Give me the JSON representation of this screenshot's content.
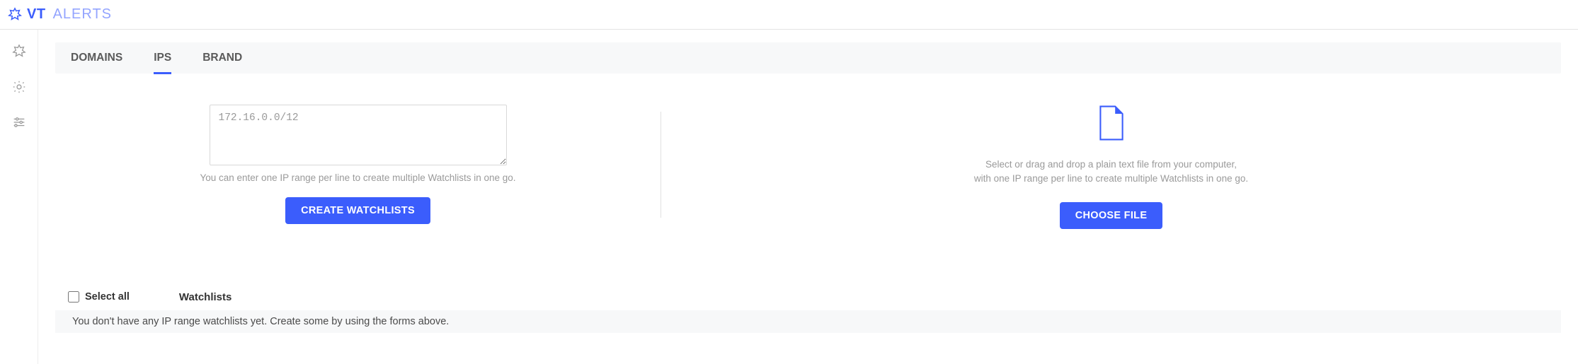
{
  "header": {
    "brand_bold": "VT",
    "brand_light": "ALERTS"
  },
  "sidebar": {
    "icons": [
      "maple-icon",
      "gear-icon",
      "sliders-icon"
    ]
  },
  "tabs": {
    "items": [
      {
        "label": "DOMAINS",
        "active": false
      },
      {
        "label": "IPS",
        "active": true
      },
      {
        "label": "BRAND",
        "active": false
      }
    ]
  },
  "ip_form": {
    "placeholder": "172.16.0.0/12",
    "hint": "You can enter one IP range per line to create multiple Watchlists in one go.",
    "button": "CREATE WATCHLISTS"
  },
  "file_form": {
    "hint_line1": "Select or drag and drop a plain text file from your computer,",
    "hint_line2": "with one IP range per line to create multiple Watchlists in one go.",
    "button": "CHOOSE FILE"
  },
  "watchlists": {
    "select_all_label": "Select all",
    "column_header": "Watchlists",
    "empty_message": "You don't have any IP range watchlists yet. Create some by using the forms above."
  }
}
